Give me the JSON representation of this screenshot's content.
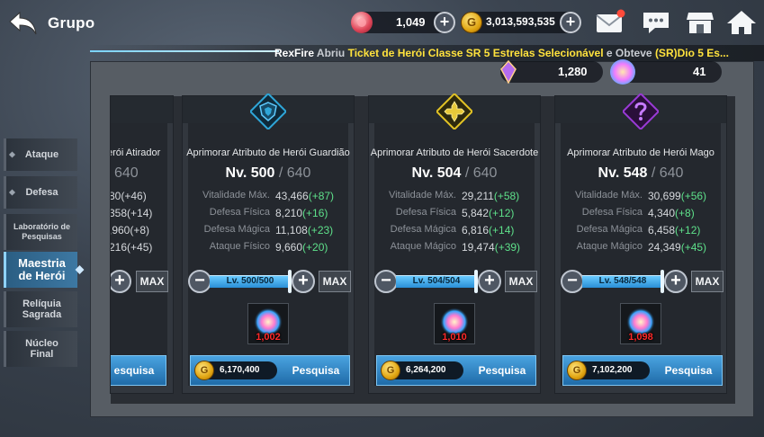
{
  "header": {
    "title": "Grupo",
    "gems": "1,049",
    "gold": "3,013,593,535",
    "currency2a": "1,280",
    "currency2b": "41"
  },
  "ticker": {
    "player": "RexFire",
    "action": "Abriu",
    "item": "Ticket de Herói Classe SR 5 Estrelas Selecionável",
    "mid": "e Obteve",
    "reward": "(SR)Dio 5 Es..."
  },
  "sidebar": {
    "items": [
      {
        "label": "Ataque"
      },
      {
        "label": "Defesa"
      },
      {
        "label": "Laboratório de Pesquisas"
      },
      {
        "label": "Maestria de Herói"
      },
      {
        "label": "Relíquia Sagrada"
      },
      {
        "label": "Núcleo Final"
      }
    ]
  },
  "partial_card": {
    "title": "erói Atirador",
    "level_max": "640",
    "stats": [
      "80(+46)",
      "358(+14)",
      ",960(+8)",
      "216(+45)"
    ],
    "research_label": "esquisa"
  },
  "cards": [
    {
      "title": "Aprimorar Atributo de Herói Guardião",
      "level": "Nv. 500",
      "level_max": "/ 640",
      "stats": [
        {
          "name": "Vitalidade Máx.",
          "value": "43,466",
          "bonus": "(+87)"
        },
        {
          "name": "Defesa Física",
          "value": "8,210",
          "bonus": "(+16)"
        },
        {
          "name": "Defesa Mágica",
          "value": "11,108",
          "bonus": "(+23)"
        },
        {
          "name": "Ataque Físico",
          "value": "9,660",
          "bonus": "(+20)"
        }
      ],
      "lv_label": "Lv. 500/500",
      "max_label": "MAX",
      "potion_count": "1,002",
      "cost": "6,170,400",
      "research_label": "Pesquisa"
    },
    {
      "title": "Aprimorar Atributo de Herói Sacerdote",
      "level": "Nv. 504",
      "level_max": "/ 640",
      "stats": [
        {
          "name": "Vitalidade Máx.",
          "value": "29,211",
          "bonus": "(+58)"
        },
        {
          "name": "Defesa Física",
          "value": "5,842",
          "bonus": "(+12)"
        },
        {
          "name": "Defesa Mágica",
          "value": "6,816",
          "bonus": "(+14)"
        },
        {
          "name": "Ataque Mágico",
          "value": "19,474",
          "bonus": "(+39)"
        }
      ],
      "lv_label": "Lv. 504/504",
      "max_label": "MAX",
      "potion_count": "1,010",
      "cost": "6,264,200",
      "research_label": "Pesquisa"
    },
    {
      "title": "Aprimorar Atributo de Herói Mago",
      "level": "Nv. 548",
      "level_max": "/ 640",
      "stats": [
        {
          "name": "Vitalidade Máx.",
          "value": "30,699",
          "bonus": "(+56)"
        },
        {
          "name": "Defesa Física",
          "value": "4,340",
          "bonus": "(+8)"
        },
        {
          "name": "Defesa Mágica",
          "value": "6,458",
          "bonus": "(+12)"
        },
        {
          "name": "Ataque Mágico",
          "value": "24,349",
          "bonus": "(+45)"
        }
      ],
      "lv_label": "Lv. 548/548",
      "max_label": "MAX",
      "potion_count": "1,098",
      "cost": "7,102,200",
      "research_label": "Pesquisa"
    }
  ],
  "icons": {
    "back": "back-arrow-icon",
    "gem": "red-gem-icon",
    "gold": "gold-coin-icon",
    "mail": "mail-icon",
    "chat": "chat-icon",
    "shop": "shop-icon",
    "home": "home-icon",
    "guardian": "guardian-shield-icon",
    "priest": "priest-cross-icon",
    "mage": "mage-question-icon"
  },
  "colors": {
    "bonus_green": "#5ee08a",
    "ticker_yellow": "#ffe23d",
    "accent_blue": "#4aa3e0",
    "guardian": "#2fa6d8",
    "priest": "#e2c325",
    "mage": "#9a3ad6"
  }
}
